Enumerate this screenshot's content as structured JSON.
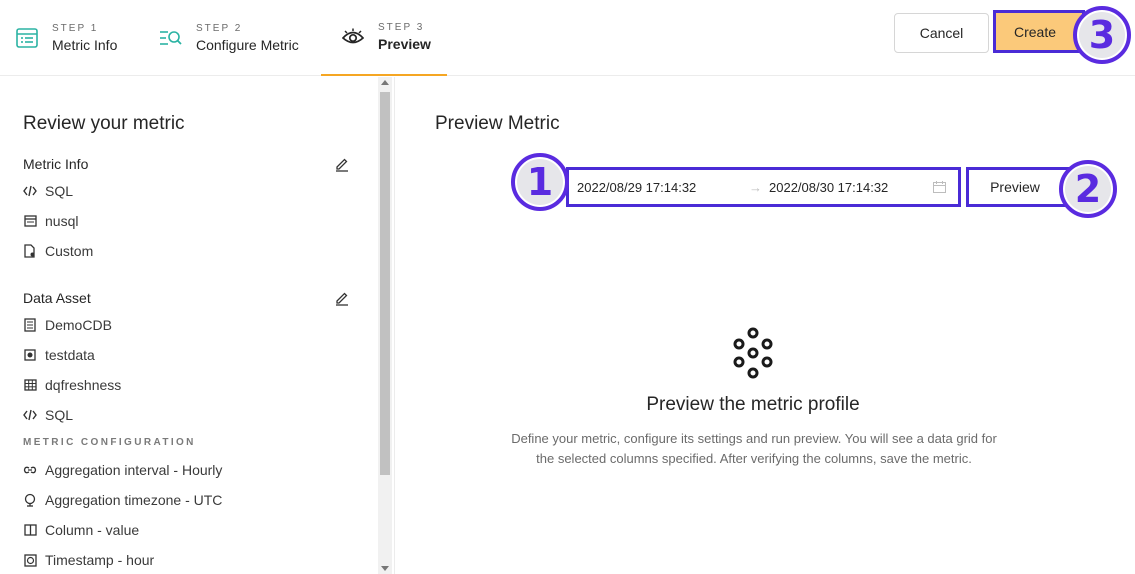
{
  "steps": [
    {
      "num": "STEP 1",
      "name": "Metric Info",
      "icon": "list-icon"
    },
    {
      "num": "STEP 2",
      "name": "Configure Metric",
      "icon": "search-list-icon"
    },
    {
      "num": "STEP 3",
      "name": "Preview",
      "icon": "eye-icon"
    }
  ],
  "actions": {
    "cancel_label": "Cancel",
    "create_label": "Create"
  },
  "annotations": {
    "one": "1",
    "two": "2",
    "three": "3"
  },
  "left": {
    "heading": "Review your metric",
    "metric_info": {
      "title": "Metric Info",
      "items": [
        {
          "label": "SQL",
          "icon": "code-icon"
        },
        {
          "label": "nusql",
          "icon": "table-icon"
        },
        {
          "label": "Custom",
          "icon": "file-icon"
        }
      ]
    },
    "data_asset": {
      "title": "Data Asset",
      "items": [
        {
          "label": "DemoCDB",
          "icon": "database-icon"
        },
        {
          "label": "testdata",
          "icon": "schema-icon"
        },
        {
          "label": "dqfreshness",
          "icon": "grid-icon"
        },
        {
          "label": "SQL",
          "icon": "code-icon"
        }
      ]
    },
    "config": {
      "title": "METRIC CONFIGURATION",
      "items": [
        {
          "label": "Aggregation interval - Hourly",
          "icon": "link-icon"
        },
        {
          "label": "Aggregation timezone - UTC",
          "icon": "globe-icon"
        },
        {
          "label": "Column - value",
          "icon": "column-icon"
        },
        {
          "label": "Timestamp - hour",
          "icon": "clock-icon"
        }
      ]
    }
  },
  "right": {
    "heading": "Preview Metric",
    "range": {
      "from": "2022/08/29 17:14:32",
      "separator": "→",
      "to": "2022/08/30 17:14:32"
    },
    "preview_label": "Preview",
    "empty": {
      "title": "Preview the metric profile",
      "description": "Define your metric, configure its settings and run preview. You will see a data grid for the selected columns specified. After verifying the columns, save the metric."
    }
  },
  "colors": {
    "accent": "#f5a623",
    "create_bg": "#fbc97a",
    "highlight": "#4a2bd6",
    "badge": "#5a2be0",
    "teal_icon": "#2bb3a3"
  }
}
